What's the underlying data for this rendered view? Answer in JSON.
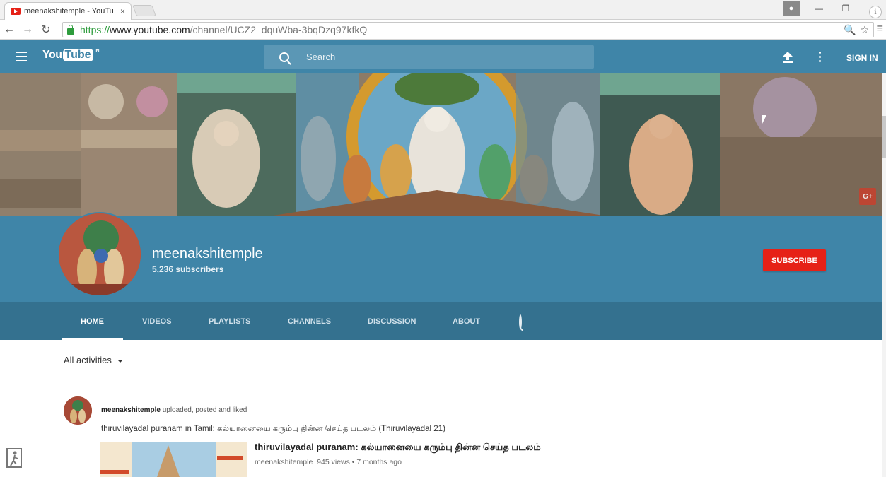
{
  "browser": {
    "tab_title": "meenakshitemple - YouTu",
    "tab_close": "×",
    "url_proto": "https://",
    "url_host": "www.youtube.com",
    "url_path": "/channel/UCZ2_dquWba-3bqDzq97kfkQ",
    "nav_back": "←",
    "nav_forward": "→",
    "nav_reload": "↻",
    "win_minimize": "—",
    "win_restore": "❐",
    "menu": "≡",
    "omni_zoom": "🔍",
    "omni_star": "☆",
    "info": "i"
  },
  "masthead": {
    "logo_you": "You",
    "logo_tube": "Tube",
    "logo_region": "IN",
    "search_placeholder": "Search",
    "sign_in": "SIGN IN"
  },
  "banner": {
    "gplus_label": "G+"
  },
  "channel": {
    "name": "meenakshitemple",
    "subscribers": "5,236 subscribers",
    "subscribe_label": "SUBSCRIBE"
  },
  "tabs": [
    {
      "label": "HOME",
      "active": true
    },
    {
      "label": "VIDEOS",
      "active": false
    },
    {
      "label": "PLAYLISTS",
      "active": false
    },
    {
      "label": "CHANNELS",
      "active": false
    },
    {
      "label": "DISCUSSION",
      "active": false
    },
    {
      "label": "ABOUT",
      "active": false
    }
  ],
  "feed": {
    "filter_label": "All activities",
    "actor_name": "meenakshitemple",
    "actor_action": " uploaded, posted and liked",
    "post_text": "thiruvilayadal puranam in Tamil: கல்யானையை கரும்பு தின்ன செய்த படலம் (Thiruvilayadal 21)",
    "video_title": "thiruvilayadal puranam: கல்யானையை கரும்பு தின்ன செய்த படலம்",
    "video_channel": "meenakshitemple",
    "video_stats": "945 views • 7 months ago"
  },
  "colors": {
    "masthead": "#3f85a8",
    "channel_tabs": "#34718f",
    "subscribe": "#e62117"
  }
}
